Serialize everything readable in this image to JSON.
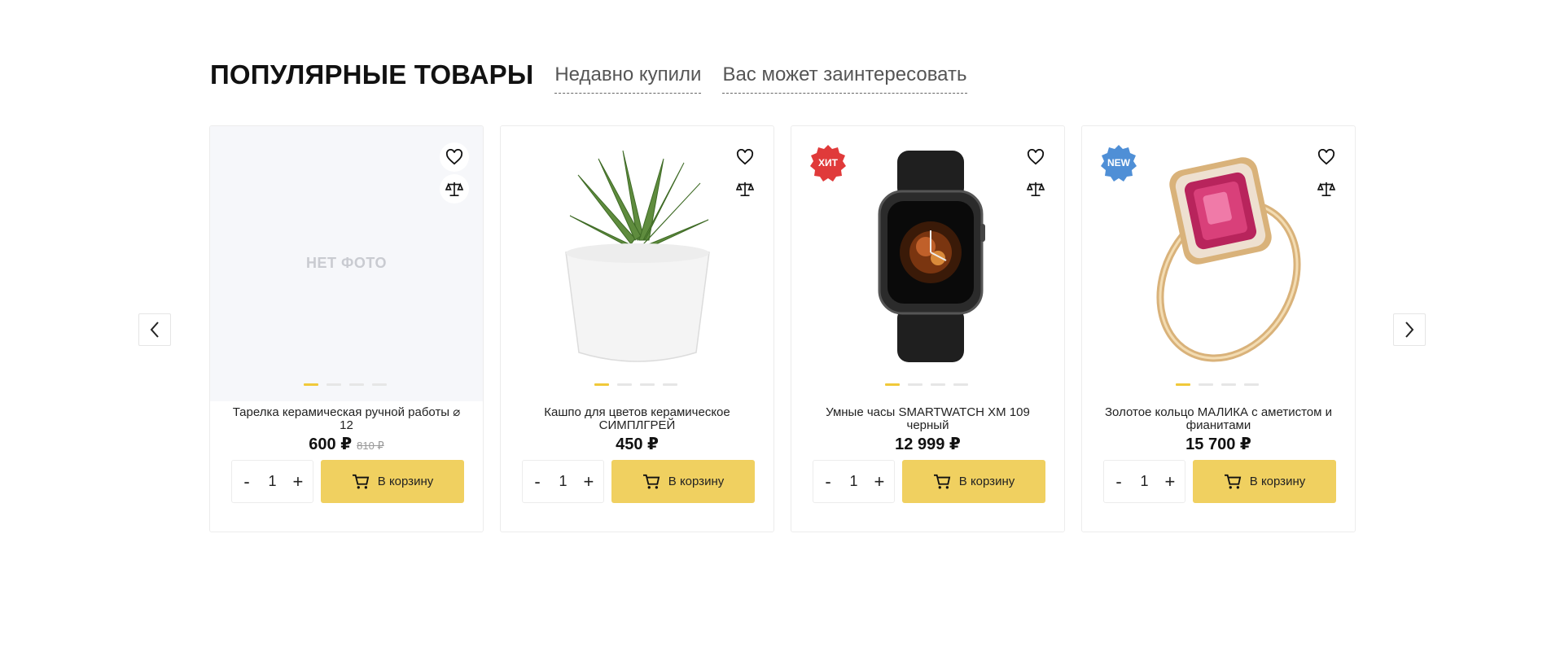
{
  "tabs": {
    "active": "ПОПУЛЯРНЫЕ ТОВАРЫ",
    "recent": "Недавно купили",
    "interest": "Вас может заинтересовать"
  },
  "colors": {
    "accent": "#f0d060",
    "badge_hit": "#e03a3a",
    "badge_new": "#4f8fd6"
  },
  "products": [
    {
      "title": "Тарелка керамическая ручной работы ⌀ 12",
      "price": "600 ₽",
      "old_price": "810 ₽",
      "no_photo": "НЕТ ФОТО",
      "qty": "1",
      "cart_label": "В корзину"
    },
    {
      "title": "Кашпо для цветов керамическое СИМПЛГРЕЙ",
      "price": "450 ₽",
      "qty": "1",
      "cart_label": "В корзину"
    },
    {
      "title": "Умные часы SMARTWATCH XM 109 черный",
      "price": "12 999 ₽",
      "badge": "ХИТ",
      "qty": "1",
      "cart_label": "В корзину"
    },
    {
      "title": "Золотое кольцо МАЛИКА с аметистом и фианитами",
      "price": "15 700 ₽",
      "badge": "NEW",
      "qty": "1",
      "cart_label": "В корзину"
    }
  ],
  "qty_controls": {
    "minus": "-",
    "plus": "+"
  }
}
